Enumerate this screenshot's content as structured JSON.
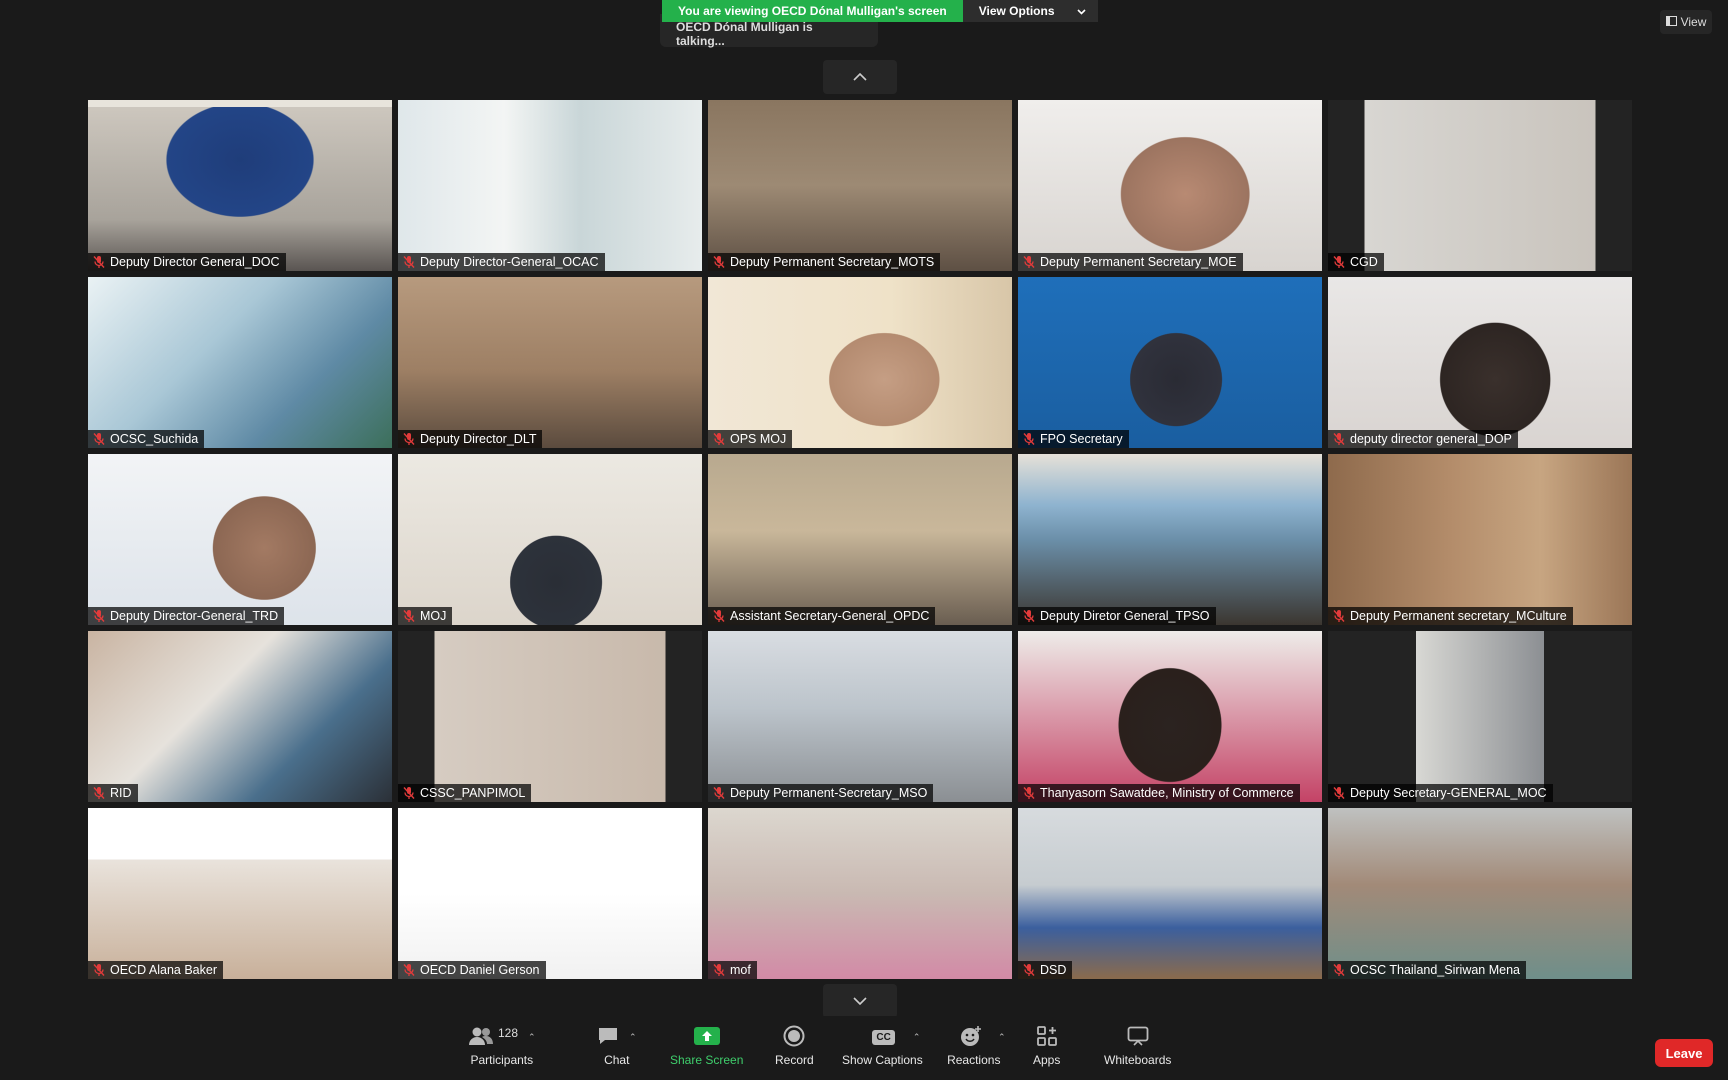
{
  "banner": {
    "viewing_text": "You are viewing OECD Dónal Mulligan's screen",
    "view_options_label": "View Options",
    "talking_text": "OECD Dónal Mulligan is talking..."
  },
  "view_button": {
    "label": "View"
  },
  "participants": [
    {
      "name": "Deputy Director General_DOC",
      "scene": "office-blue-wall"
    },
    {
      "name": "Deputy Director-General_OCAC",
      "scene": "office-group"
    },
    {
      "name": "Deputy Permanent Secretary_MOTS",
      "scene": "conference-logo"
    },
    {
      "name": "Deputy Permanent Secretary_MOE",
      "scene": "closeup-man"
    },
    {
      "name": "CGD",
      "scene": "portrait-woman-bars"
    },
    {
      "name": "OCSC_Suchida",
      "scene": "happy-new-year"
    },
    {
      "name": "Deputy Director_DLT",
      "scene": "meeting-room-wood"
    },
    {
      "name": "OPS MOJ",
      "scene": "woman-mask-gold"
    },
    {
      "name": "FPO Secretary",
      "scene": "blue-backdrop"
    },
    {
      "name": "deputy director general_DOP",
      "scene": "woman-mask-white"
    },
    {
      "name": "Deputy Director-General_TRD",
      "scene": "man-glasses-white"
    },
    {
      "name": "MOJ",
      "scene": "man-suit"
    },
    {
      "name": "Assistant Secretary-General_OPDC",
      "scene": "meeting-table"
    },
    {
      "name": "Deputy Diretor General_TPSO",
      "scene": "conference-window"
    },
    {
      "name": "Deputy Permanent secretary_MCulture",
      "scene": "wood-office"
    },
    {
      "name": "RID",
      "scene": "blurry-closeup"
    },
    {
      "name": "CSSC_PANPIMOL",
      "scene": "woman-glasses-bars"
    },
    {
      "name": "Deputy Permanent-Secretary_MSO",
      "scene": "ministry-social"
    },
    {
      "name": "Thanyasorn Sawatdee, Ministry of Commerce",
      "scene": "woman-red"
    },
    {
      "name": "Deputy Secretary-GENERAL_MOC",
      "scene": "narrow-office"
    },
    {
      "name": "OECD Alana Baker",
      "scene": "oecd-banner-woman"
    },
    {
      "name": "OECD Daniel Gerson",
      "scene": "oecd-banner-man"
    },
    {
      "name": "mof",
      "scene": "woman-pink"
    },
    {
      "name": "DSD",
      "scene": "man-blue-desk"
    },
    {
      "name": "OCSC Thailand_Siriwan Mena",
      "scene": "woman-red-hair"
    }
  ],
  "toolbar": {
    "participants_label": "Participants",
    "participants_count": "128",
    "chat_label": "Chat",
    "share_label": "Share Screen",
    "record_label": "Record",
    "captions_label": "Show Captions",
    "captions_badge": "CC",
    "reactions_label": "Reactions",
    "apps_label": "Apps",
    "whiteboards_label": "Whiteboards",
    "leave_label": "Leave"
  },
  "colors": {
    "banner_green": "#24b14b",
    "leave_red": "#e02828",
    "share_green": "#3fce6c",
    "mute_red": "#e23b3b"
  }
}
